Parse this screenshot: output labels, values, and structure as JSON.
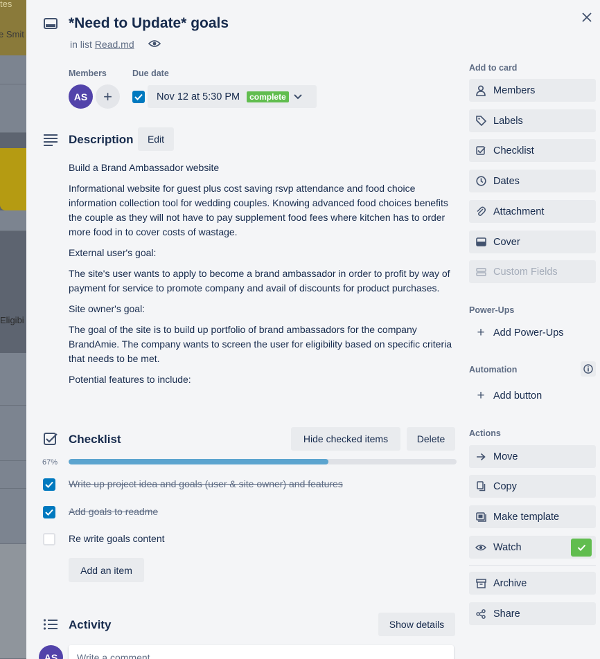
{
  "background": {
    "top_text": "tes",
    "member_snippet": "e Smit",
    "card_snippet": "Eligibi"
  },
  "card": {
    "title": "*Need to Update* goals",
    "in_list_prefix": "in list",
    "list_name": "Read.md"
  },
  "members": {
    "label": "Members",
    "avatar_initials": "AS"
  },
  "due_date": {
    "label": "Due date",
    "value": "Nov 12 at 5:30 PM",
    "status": "complete",
    "checked": true
  },
  "description": {
    "title": "Description",
    "edit_label": "Edit",
    "paragraphs": [
      "Build a Brand Ambassador website",
      "Informational website for guest plus cost saving rsvp attendance and food choice information collection tool for wedding couples. Knowing advanced food choices benefits the couple as they will not have to pay supplement food fees where kitchen has to order more food in to cover costs of wastage.",
      "External user's goal:",
      "The site's user wants to apply to become a brand ambassador in order to profit by way of payment for service to promote company and avail of discounts for product purchases.",
      "Site owner's goal:",
      "The goal of the site is to build up portfolio of brand ambassadors for the company BrandAmie. The company wants to screen the user for eligibility based on specific criteria that needs to be met.",
      "Potential features to include:"
    ]
  },
  "checklist": {
    "title": "Checklist",
    "hide_checked_label": "Hide checked items",
    "delete_label": "Delete",
    "percent_label": "67%",
    "progress": 0.67,
    "items": [
      {
        "text": "Write up project idea and goals (user & site owner) and features",
        "checked": true
      },
      {
        "text": "Add goals to readme",
        "checked": true
      },
      {
        "text": "Re write goals content",
        "checked": false
      }
    ],
    "add_item_label": "Add an item"
  },
  "activity": {
    "title": "Activity",
    "show_details_label": "Show details",
    "comment_placeholder": "Write a comment..."
  },
  "sidebar": {
    "add_to_card_label": "Add to card",
    "add_to_card": [
      {
        "label": "Members",
        "icon": "person-icon"
      },
      {
        "label": "Labels",
        "icon": "tag-icon"
      },
      {
        "label": "Checklist",
        "icon": "checklist-icon"
      },
      {
        "label": "Dates",
        "icon": "clock-icon"
      },
      {
        "label": "Attachment",
        "icon": "paperclip-icon"
      },
      {
        "label": "Cover",
        "icon": "cover-icon"
      },
      {
        "label": "Custom Fields",
        "icon": "custom-fields-icon"
      }
    ],
    "powerups_label": "Power-Ups",
    "add_powerups_label": "Add Power-Ups",
    "automation_label": "Automation",
    "add_button_label": "Add button",
    "actions_label": "Actions",
    "actions": [
      {
        "label": "Move",
        "icon": "arrow-right-icon"
      },
      {
        "label": "Copy",
        "icon": "copy-icon"
      },
      {
        "label": "Make template",
        "icon": "template-icon"
      },
      {
        "label": "Watch",
        "icon": "eye-icon"
      },
      {
        "label": "Archive",
        "icon": "archive-icon"
      },
      {
        "label": "Share",
        "icon": "share-icon"
      }
    ]
  },
  "colors": {
    "accent": "#0079bf",
    "complete_green": "#61bd4f",
    "avatar_purple": "#5243aa",
    "progress_fill": "#5ba4cf"
  }
}
